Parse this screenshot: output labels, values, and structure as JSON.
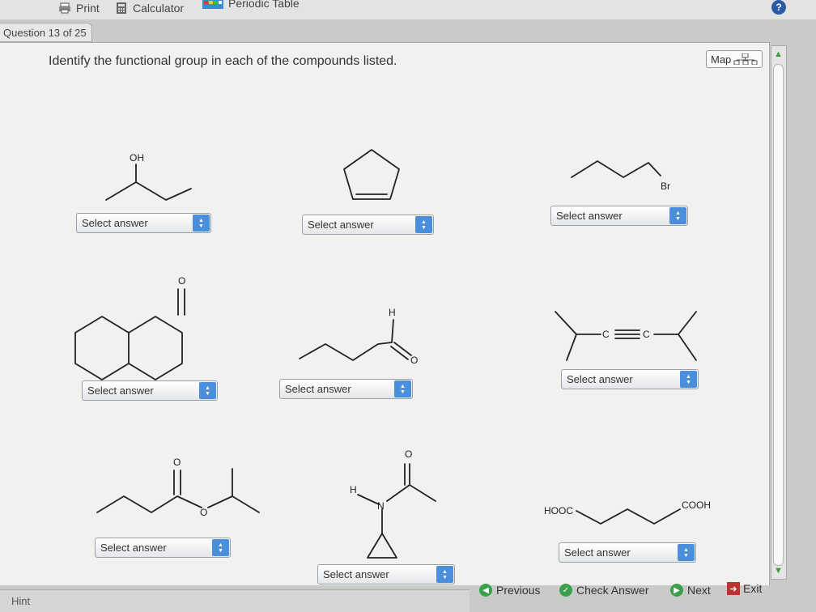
{
  "toolbar": {
    "print": "Print",
    "calculator": "Calculator",
    "periodic_table": "Periodic Table",
    "help": "?"
  },
  "question_tab": "Question 13 of 25",
  "instruction": "Identify the functional group in each of the compounds listed.",
  "map_button": "Map",
  "structures": {
    "s1_oh": "OH",
    "s3_br": "Br",
    "s4_o": "O",
    "s5_h": "H",
    "s5_o": "O",
    "s6_c1": "C",
    "s6_c2": "C",
    "s7_o1": "O",
    "s7_o2": "O",
    "s8_o": "O",
    "s8_h": "H",
    "s8_n": "N",
    "s9_hooc": "HOOC",
    "s9_cooh": "COOH"
  },
  "answers": [
    "Select answer",
    "Select answer",
    "Select answer",
    "Select answer",
    "Select answer",
    "Select answer",
    "Select answer",
    "Select answer",
    "Select answer"
  ],
  "footer": {
    "hint": "Hint",
    "previous": "Previous",
    "check_answer": "Check Answer",
    "next": "Next",
    "exit": "Exit"
  },
  "colors": {
    "select_button": "#4a8fdc",
    "nav_icon": "#3aa04a",
    "exit_icon": "#c03030"
  }
}
